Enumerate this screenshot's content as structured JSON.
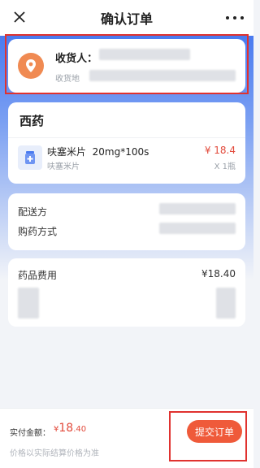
{
  "header": {
    "title": "确认订单",
    "close_icon": "close-icon",
    "more_icon": "more-icon"
  },
  "address": {
    "receiver_label": "收货人：",
    "address_label": "收货地",
    "pin_icon": "location-pin-icon"
  },
  "medicine": {
    "section_title": "西药",
    "items": [
      {
        "name": "呋塞米片",
        "spec": "20mg*100s",
        "generic_name": "呋塞米片",
        "price": "¥ 18.4",
        "quantity": "X 1瓶"
      }
    ]
  },
  "delivery": {
    "delivery_label": "配送方",
    "purchase_label": "购药方式"
  },
  "fees": {
    "drug_fee_label": "药品费用",
    "drug_fee_value": "¥18.40"
  },
  "footer": {
    "pay_label": "实付金额：",
    "pay_symbol": "¥",
    "pay_integer": "18",
    "pay_decimal": ".40",
    "note": "价格以实际结算价格为准",
    "submit_label": "提交订单"
  },
  "colors": {
    "accent": "#ef5a3a",
    "price_red": "#e24a3b",
    "header_blue": "#4a7bf0",
    "highlight_frame": "#e0322f"
  }
}
